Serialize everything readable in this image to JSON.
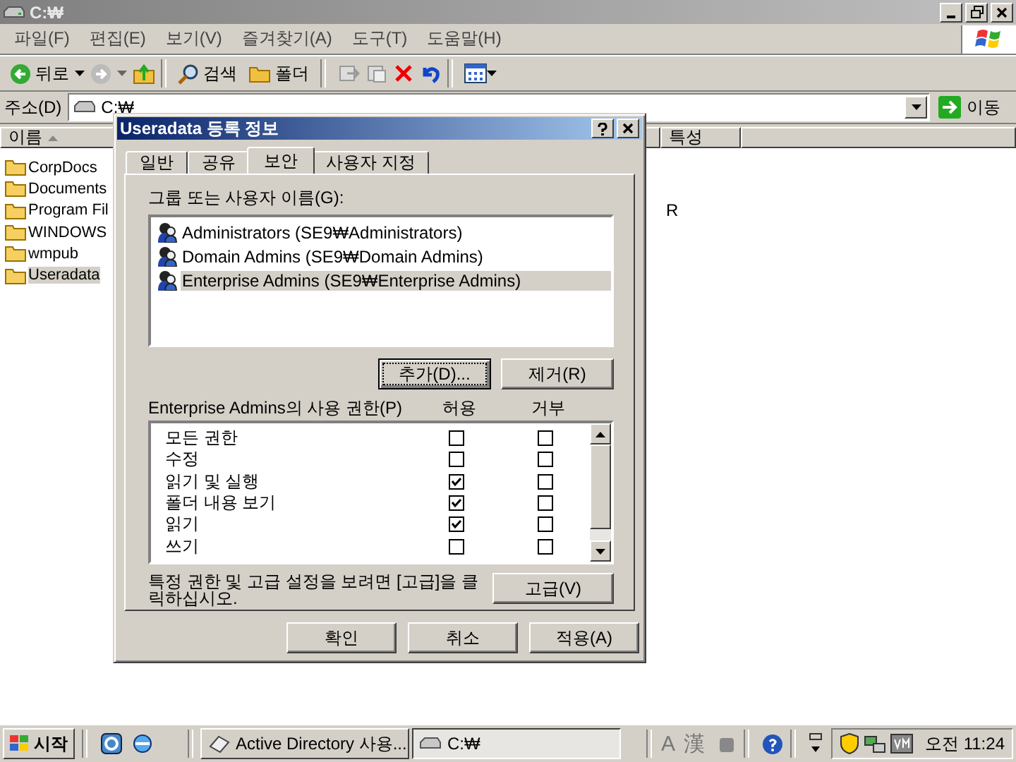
{
  "window": {
    "title": "C:₩"
  },
  "menu": [
    "파일(F)",
    "편집(E)",
    "보기(V)",
    "즐겨찾기(A)",
    "도구(T)",
    "도움말(H)"
  ],
  "toolbar": {
    "back": "뒤로",
    "search": "검색",
    "folders": "폴더"
  },
  "address": {
    "label": "주소(D)",
    "value": "C:₩",
    "go": "이동"
  },
  "list": {
    "columns": [
      "이름",
      "특성"
    ],
    "items": [
      {
        "name": "CorpDocs",
        "selected": false
      },
      {
        "name": "Documents",
        "selected": false
      },
      {
        "name": "Program Fil",
        "selected": false,
        "attribute": "R"
      },
      {
        "name": "WINDOWS",
        "selected": false
      },
      {
        "name": "wmpub",
        "selected": false
      },
      {
        "name": "Useradata",
        "selected": true
      }
    ]
  },
  "dialog": {
    "title": "Useradata 등록 정보",
    "tabs": [
      {
        "label": "일반",
        "selected": false
      },
      {
        "label": "공유",
        "selected": false
      },
      {
        "label": "보안",
        "selected": true
      },
      {
        "label": "사용자 지정",
        "selected": false
      }
    ],
    "group_label": "그룹 또는 사용자 이름(G):",
    "users": [
      {
        "name": "Administrators (SE9₩Administrators)",
        "selected": false
      },
      {
        "name": "Domain Admins (SE9₩Domain Admins)",
        "selected": false
      },
      {
        "name": "Enterprise Admins (SE9₩Enterprise Admins)",
        "selected": true
      }
    ],
    "add_button": "추가(D)...",
    "remove_button": "제거(R)",
    "permissions_label": "Enterprise Admins의 사용 권한(P)",
    "allow_label": "허용",
    "deny_label": "거부",
    "permissions": [
      {
        "name": "모든 권한",
        "allow": false,
        "deny": false
      },
      {
        "name": "수정",
        "allow": false,
        "deny": false
      },
      {
        "name": "읽기 및 실행",
        "allow": true,
        "deny": false
      },
      {
        "name": "폴더 내용 보기",
        "allow": true,
        "deny": false
      },
      {
        "name": "읽기",
        "allow": true,
        "deny": false
      },
      {
        "name": "쓰기",
        "allow": false,
        "deny": false
      }
    ],
    "note": "특정 권한 및 고급 설정을 보려면 [고급]을 클릭하십시오.",
    "advanced_button": "고급(V)",
    "buttons": [
      "확인",
      "취소",
      "적용(A)"
    ]
  },
  "taskbar": {
    "start": "시작",
    "tasks": [
      {
        "label": "Active Directory 사용...",
        "selected": false
      },
      {
        "label": "C:₩",
        "selected": true
      }
    ],
    "ime": [
      "A",
      "漢"
    ],
    "clock": "오전 11:24"
  }
}
